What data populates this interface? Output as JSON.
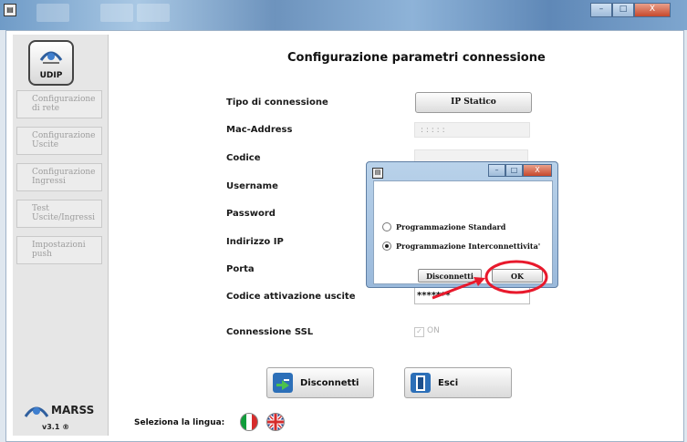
{
  "window": {
    "minimize_glyph": "–",
    "maximize_glyph": "□",
    "close_glyph": "X"
  },
  "sidebar": {
    "logo_text": "UDIP",
    "items": [
      {
        "label": "Configurazione di rete"
      },
      {
        "label": "Configurazione Uscite"
      },
      {
        "label": "Configurazione Ingressi"
      },
      {
        "label": "Test Uscite/Ingressi"
      },
      {
        "label": "Impostazioni push"
      }
    ],
    "brand": "MARSS",
    "version": "v3.1 ®"
  },
  "main": {
    "title": "Configurazione parametri connessione",
    "tipo_label": "Tipo di connessione",
    "tipo_value": "IP Statico",
    "mac_label": "Mac-Address",
    "mac_value": ": : : : :",
    "codice_label": "Codice",
    "username_label": "Username",
    "password_label": "Password",
    "ip_label": "Indirizzo IP",
    "porta_label": "Porta",
    "codice_att_label": "Codice attivazione uscite",
    "codice_att_value": "*******",
    "ssl_label": "Connessione SSL",
    "ssl_value": "ON",
    "disconnetti_label": "Disconnetti",
    "esci_label": "Esci",
    "lang_label": "Seleziona la lingua:"
  },
  "dialog": {
    "options": [
      {
        "label": "Programmazione Standard",
        "selected": false
      },
      {
        "label": "Programmazione Interconnettivita'",
        "selected": true
      }
    ],
    "disconnetti_label": "Disconnetti",
    "ok_label": "OK"
  },
  "colors": {
    "annotation": "#e8192c"
  }
}
